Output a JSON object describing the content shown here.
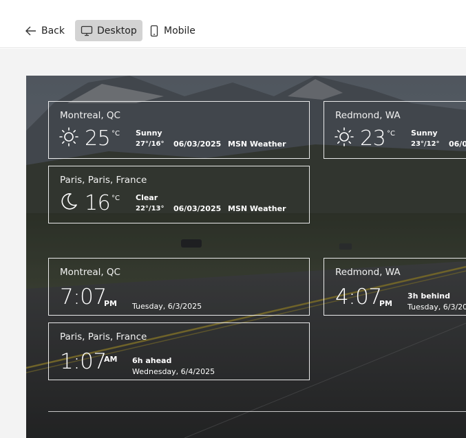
{
  "toolbar": {
    "back_label": "Back",
    "desktop_label": "Desktop",
    "mobile_label": "Mobile"
  },
  "weather": [
    {
      "city": "Montreal, QC",
      "temp": "25",
      "unit": "°C",
      "condition": "Sunny",
      "hilo": "27°/16°",
      "date": "06/03/2025",
      "source": "MSN Weather",
      "icon": "sun-icon"
    },
    {
      "city": "Redmond, WA",
      "temp": "23",
      "unit": "°C",
      "condition": "Sunny",
      "hilo": "23°/12°",
      "date": "06/0",
      "source": "",
      "icon": "sun-icon"
    },
    {
      "city": "Paris, Paris, France",
      "temp": "16",
      "unit": "°C",
      "condition": "Clear",
      "hilo": "22°/13°",
      "date": "06/03/2025",
      "source": "MSN Weather",
      "icon": "moon-icon"
    }
  ],
  "clocks": [
    {
      "city": "Montreal, QC",
      "time": "7:07",
      "ampm": "PM",
      "offset": "",
      "date": "Tuesday, 6/3/2025"
    },
    {
      "city": "Redmond, WA",
      "time": "4:07",
      "ampm": "PM",
      "offset": "3h behind",
      "date": "Tuesday, 6/3/202"
    },
    {
      "city": "Paris, Paris, France",
      "time": "1:07",
      "ampm": "AM",
      "offset": "6h ahead",
      "date": "Wednesday, 6/4/2025"
    }
  ]
}
